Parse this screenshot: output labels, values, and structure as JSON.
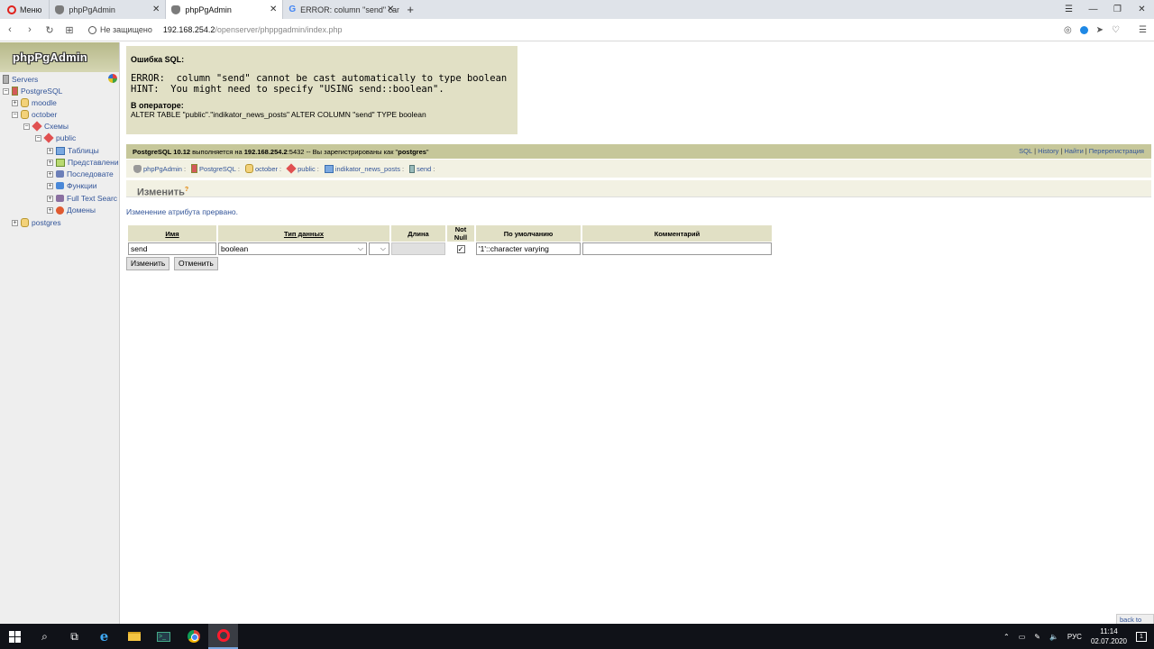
{
  "browser": {
    "menu_label": "Меню",
    "tabs": [
      {
        "title": "phpPgAdmin",
        "active": false
      },
      {
        "title": "phpPgAdmin",
        "active": true
      },
      {
        "title": "ERROR: column \"send\" can",
        "active": false
      }
    ],
    "new_tab": "+",
    "security_label": "Не защищено",
    "url_host": "192.168.254.2",
    "url_path": "/openserver/phppgadmin/index.php"
  },
  "sidebar": {
    "logo": "phpPgAdmin",
    "tree": {
      "servers": "Servers",
      "postgresql": "PostgreSQL",
      "moodle": "moodle",
      "october": "october",
      "schemas": "Схемы",
      "public": "public",
      "tables": "Таблицы",
      "views": "Представлени",
      "sequences": "Последовате",
      "functions": "Функции",
      "fts": "Full Text Searc",
      "domains": "Домены",
      "postgres": "postgres"
    }
  },
  "error": {
    "title": "Ошибка SQL:",
    "line1": "ERROR:  column \"send\" cannot be cast automatically to type boolean",
    "line2": "HINT:  You might need to specify \"USING send::boolean\".",
    "operator_label": "В операторе:",
    "statement": "ALTER TABLE \"public\".\"indikator_news_posts\" ALTER COLUMN \"send\" TYPE boolean"
  },
  "topbar": {
    "server": "PostgreSQL 10.12",
    "running_on": " выполняется на ",
    "host": "192.168.254.2",
    "port": ":5432",
    "logged_in": " -- Вы зарегистрированы как \"",
    "user": "postgres",
    "end_quote": "\"",
    "links": {
      "sql": "SQL",
      "history": "History",
      "find": "Найти",
      "logout": "Перерегистрация"
    }
  },
  "trail": {
    "phppgadmin": "phpPgAdmin",
    "server": "PostgreSQL",
    "database": "october",
    "schema": "public",
    "table": "indikator_news_posts",
    "column": "send"
  },
  "heading": {
    "title": "Изменить",
    "help": "?"
  },
  "status_message": "Изменение атрибута прервано.",
  "attr_form": {
    "headers": {
      "name": "Имя",
      "type": "Тип данных",
      "length": "Длина",
      "notnull": "Not Null",
      "default": "По умолчанию",
      "comment": "Комментарий"
    },
    "values": {
      "name": "send",
      "type": "boolean",
      "array": "",
      "length": "",
      "notnull_checked": true,
      "default": "'1'::character varying",
      "comment": ""
    }
  },
  "buttons": {
    "alter": "Изменить",
    "cancel": "Отменить"
  },
  "back_to_top": "back to top",
  "taskbar": {
    "lang": "РУС",
    "time": "11:14",
    "date": "02.07.2020",
    "notifications": "1"
  }
}
